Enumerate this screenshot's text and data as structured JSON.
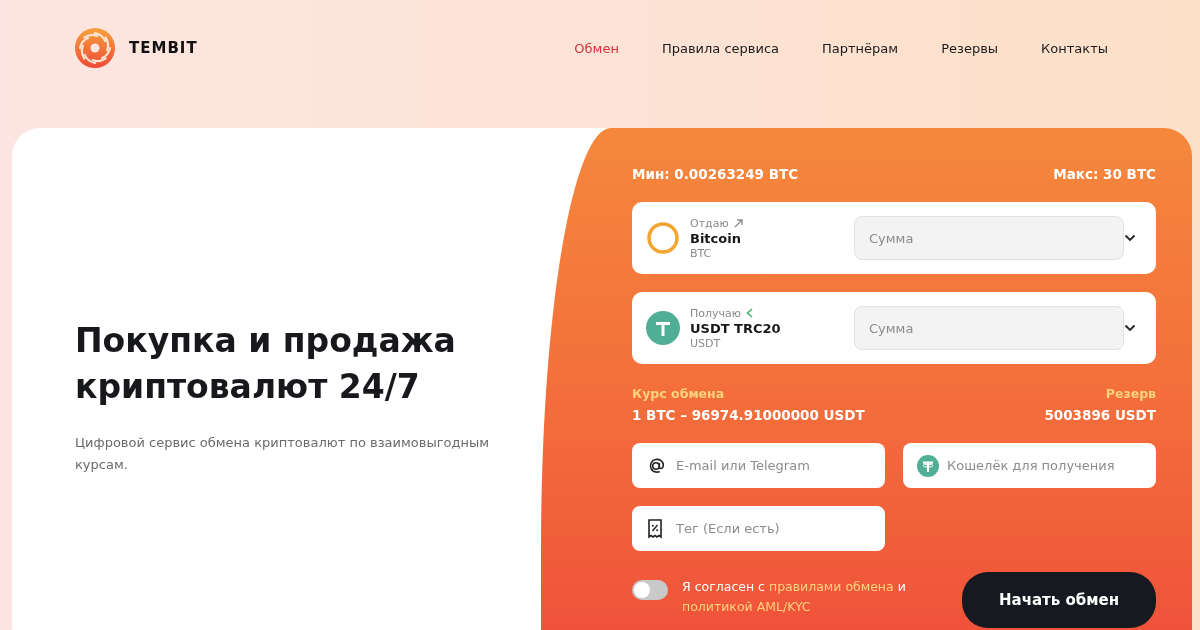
{
  "brand": {
    "name": "TEMBIT"
  },
  "nav": [
    {
      "label": "Обмен",
      "selected": true
    },
    {
      "label": "Правила сервиса",
      "selected": false
    },
    {
      "label": "Партнёрам",
      "selected": false
    },
    {
      "label": "Резервы",
      "selected": false
    },
    {
      "label": "Контакты",
      "selected": false
    }
  ],
  "hero": {
    "title_lines": [
      "Покупка и продажа",
      "криптовалют 24/7"
    ],
    "subtitle": "Цифровой сервис обмена криптовалют по взаимовыгодным курсам."
  },
  "exchange": {
    "min": "Мин: 0.00263249 BTC",
    "max": "Макс: 30 BTC",
    "pairs": [
      {
        "kind": "give",
        "label": "Отдаю",
        "name": "Bitcoin",
        "ticker": "BTC",
        "amount_placeholder": "Сумма"
      },
      {
        "kind": "receive",
        "label": "Получаю",
        "name": "USDT TRC20",
        "ticker": "USDT",
        "amount_placeholder": "Сумма"
      }
    ],
    "rate_label": "Курс обмена",
    "rate": "1 BTC – 96974.91000000 USDT",
    "reserve_label": "Резерв",
    "reserve": "5003896 USDT",
    "fields": [
      {
        "kind": "contact",
        "placeholder": "E-mail или Telegram"
      },
      {
        "kind": "wallet",
        "placeholder": "Кошелёк для получения"
      },
      {
        "kind": "tag",
        "placeholder": "Тег (Если есть)"
      }
    ],
    "agree": {
      "on": false,
      "parts": [
        {
          "kind": "text",
          "text": "Я согласен с "
        },
        {
          "kind": "link",
          "text": "правилами обмена"
        },
        {
          "kind": "text",
          "text": " и "
        },
        {
          "kind": "link",
          "text": "политикой AML/KYC"
        }
      ]
    },
    "submit": "Начать обмен"
  }
}
